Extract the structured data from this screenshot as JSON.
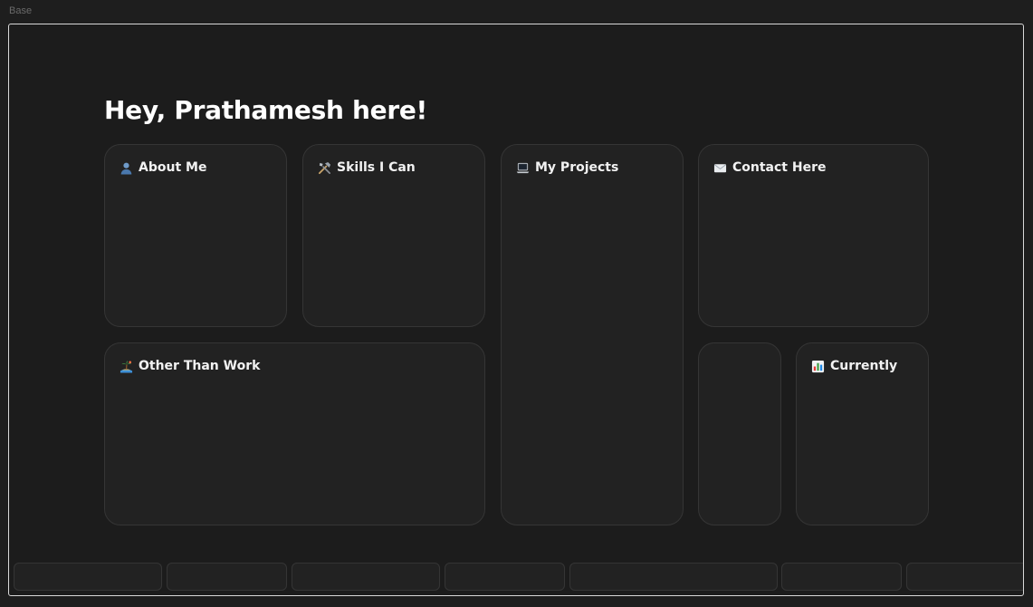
{
  "frame": {
    "label": "Base"
  },
  "header": {
    "title": "Hey, Prathamesh here!"
  },
  "cards": {
    "about": {
      "title": "About Me",
      "icon": "user-icon"
    },
    "skills": {
      "title": "Skills I Can",
      "icon": "tools-icon"
    },
    "projects": {
      "title": "My Projects",
      "icon": "laptop-icon"
    },
    "contact": {
      "title": "Contact Here",
      "icon": "envelope-icon"
    },
    "other": {
      "title": "Other Than Work",
      "icon": "island-icon"
    },
    "currently": {
      "title": "Currently",
      "icon": "bar-chart-icon"
    }
  },
  "theme": {
    "background": "#1c1c1c",
    "card": "#222222",
    "card_border": "#353535",
    "text": "#ffffff"
  }
}
